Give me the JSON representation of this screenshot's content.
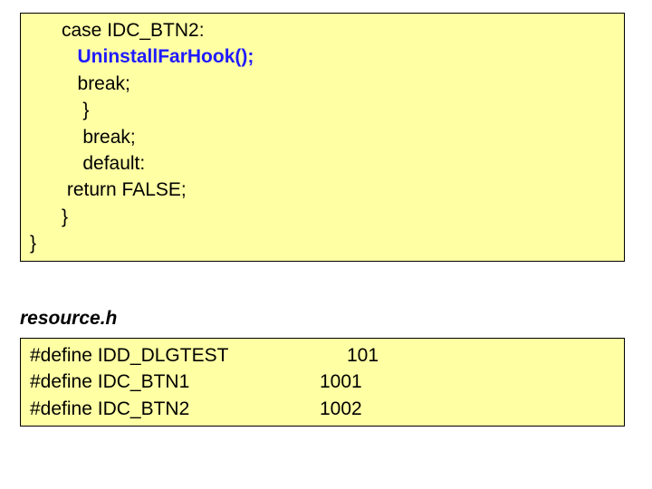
{
  "box1": {
    "line1_pre": "      case IDC_BTN2:",
    "line2_indent": "         ",
    "line2_call": "UninstallFarHook();",
    "line3": "         break;",
    "line4": "          }",
    "line5": "          break;",
    "line6": "          default:",
    "line7": "       return FALSE;",
    "line8": "      }",
    "line9": "}"
  },
  "label": "resource.h",
  "box2": {
    "rows": [
      {
        "left": "#define IDD_DLGTEST",
        "val": "101",
        "cls": "define-val-101"
      },
      {
        "left": "#define IDC_BTN1",
        "val": "1001",
        "cls": ""
      },
      {
        "left": "#define IDC_BTN2",
        "val": "1002",
        "cls": ""
      }
    ]
  }
}
